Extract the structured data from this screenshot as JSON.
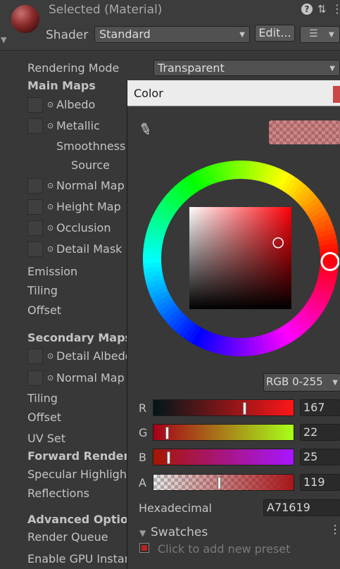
{
  "header": {
    "title": "Selected (Material)",
    "shader_label": "Shader",
    "shader_value": "Standard",
    "edit_label": "Edit...",
    "help_glyph": "?",
    "sliders_glyph": "⇅",
    "kebab_glyph": "⋮",
    "list_glyph": "☰"
  },
  "inspector": {
    "rendering_mode_label": "Rendering Mode",
    "rendering_mode_value": "Transparent",
    "main_maps": "Main Maps",
    "albedo": "Albedo",
    "metallic": "Metallic",
    "smoothness": "Smoothness",
    "source": "Source",
    "normal_map": "Normal Map",
    "height_map": "Height Map",
    "occlusion": "Occlusion",
    "detail_mask": "Detail Mask",
    "emission": "Emission",
    "tiling": "Tiling",
    "offset": "Offset",
    "secondary_maps": "Secondary Maps",
    "detail_albedo": "Detail Albedo",
    "normal_map_2": "Normal Map",
    "tiling_2": "Tiling",
    "offset_2": "Offset",
    "uv_set": "UV Set",
    "forward_rendering": "Forward Rendering",
    "specular_highlights": "Specular Highlights",
    "reflections": "Reflections",
    "advanced_options": "Advanced Options",
    "render_queue": "Render Queue",
    "enable_gpu": "Enable GPU Instancing"
  },
  "picker": {
    "title": "Color",
    "mode": "RGB 0-255",
    "channels": [
      {
        "label": "R",
        "value": "167",
        "fraction": 0.655
      },
      {
        "label": "G",
        "value": "22",
        "fraction": 0.086
      },
      {
        "label": "B",
        "value": "25",
        "fraction": 0.098
      },
      {
        "label": "A",
        "value": "119",
        "fraction": 0.467
      }
    ],
    "hex_label": "Hexadecimal",
    "hex_value": "A71619",
    "swatches_label": "Swatches",
    "preset_hint": "Click to add new preset",
    "color": "#a71619",
    "hue_deg": 358,
    "saturation": 0.87,
    "brightness": 0.65
  }
}
